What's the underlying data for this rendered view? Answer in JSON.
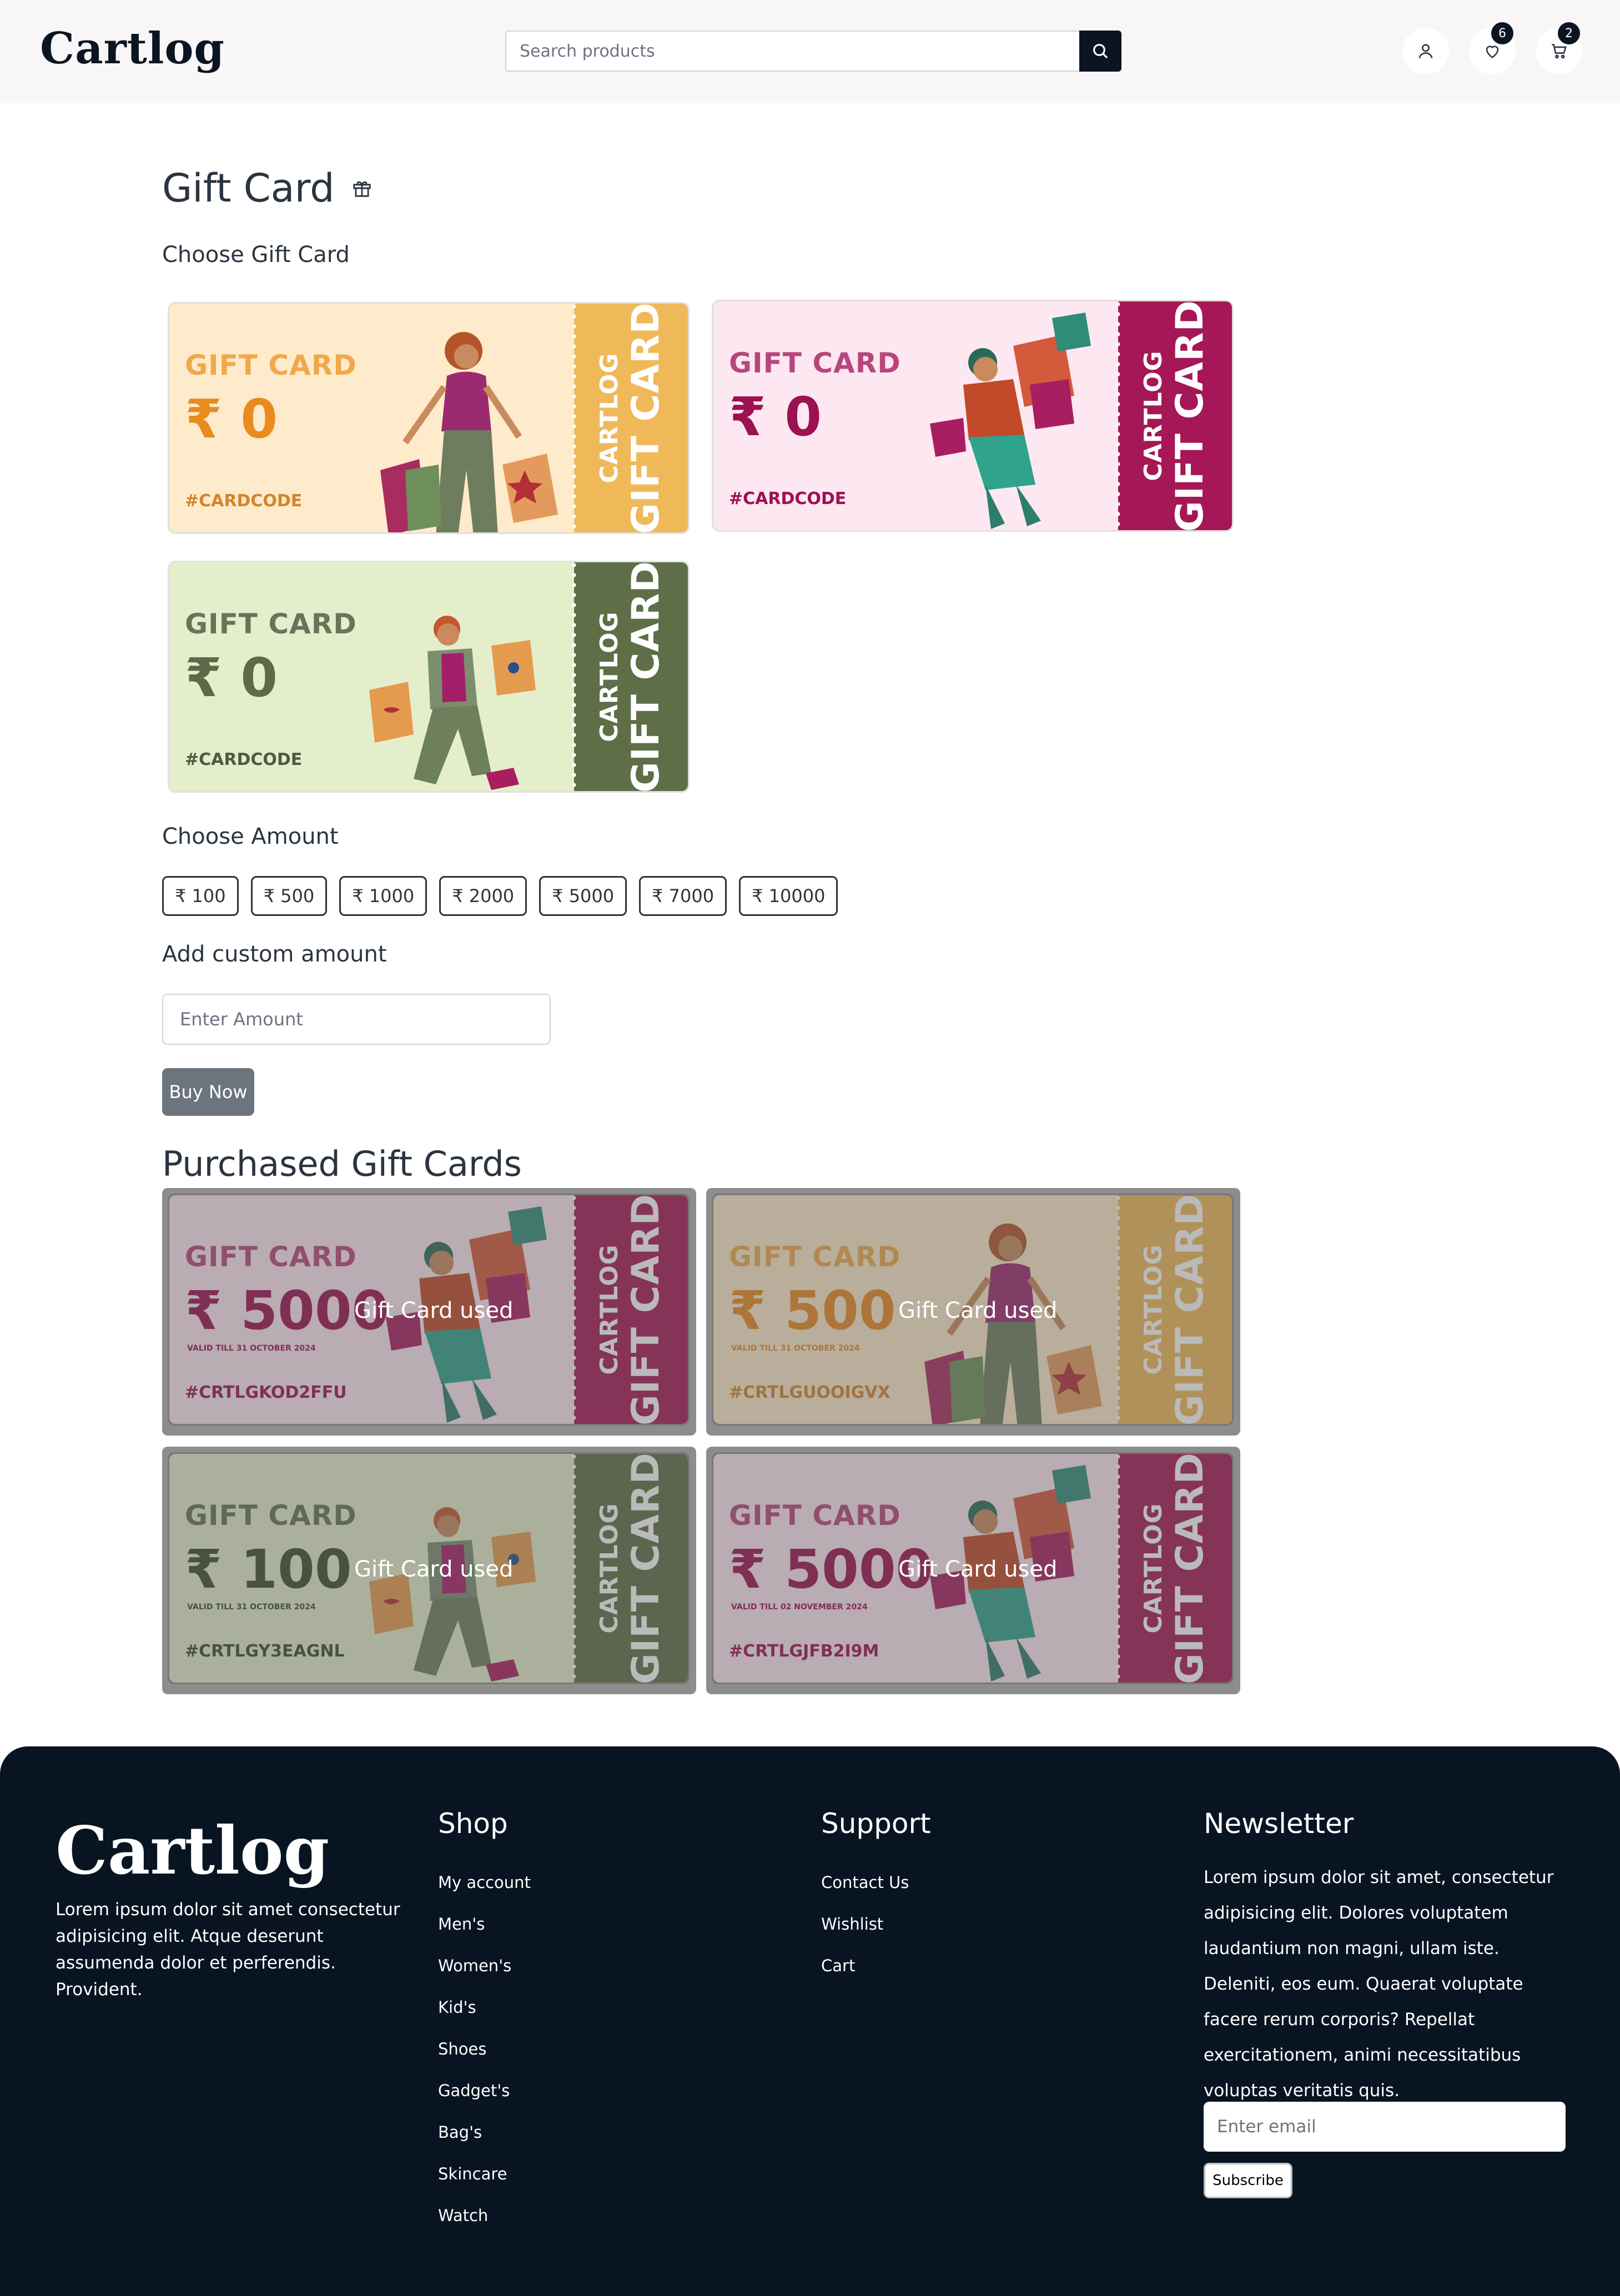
{
  "header": {
    "logo": "Cartlog",
    "search_placeholder": "Search products",
    "wishlist_count": "6",
    "cart_count": "2"
  },
  "main": {
    "title": "Gift Card",
    "choose_card_label": "Choose Gift Card",
    "choose_amount_label": "Choose Amount",
    "custom_amount_label": "Add custom amount",
    "custom_amount_placeholder": "Enter Amount",
    "buy_label": "Buy Now",
    "purchased_title": "Purchased Gift Cards"
  },
  "gift_cards": [
    {
      "label": "GIFT CARD",
      "amount": "₹ 0",
      "code": "#CARDCODE",
      "stub_top": "CARTLOG",
      "stub_bottom": "GIFT CARD",
      "bg": "#fdebcb",
      "stub": "#efb95a",
      "accent": "#efa94a",
      "amount_color": "#e98b1f",
      "code_color": "#d2852c"
    },
    {
      "label": "GIFT CARD",
      "amount": "₹ 0",
      "code": "#CARDCODE",
      "stub_top": "CARTLOG",
      "stub_bottom": "GIFT CARD",
      "bg": "#fde7f1",
      "stub": "#a51756",
      "accent": "#b8467c",
      "amount_color": "#9c1150",
      "code_color": "#9c1150"
    },
    {
      "label": "GIFT CARD",
      "amount": "₹ 0",
      "code": "#CARDCODE",
      "stub_top": "CARTLOG",
      "stub_bottom": "GIFT CARD",
      "bg": "#e4eecb",
      "stub": "#5e6e47",
      "accent": "#67735a",
      "amount_color": "#5d6a4a",
      "code_color": "#4d5940"
    }
  ],
  "amounts": [
    "₹ 100",
    "₹ 500",
    "₹ 1000",
    "₹ 2000",
    "₹ 5000",
    "₹ 7000",
    "₹ 10000"
  ],
  "purchased": [
    {
      "label": "GIFT CARD",
      "amount": "₹ 5000",
      "valid": "VALID TILL 31 OCTOBER 2024",
      "code": "#CRTLGKOD2FFU",
      "status": "Gift Card used",
      "stub_top": "CARTLOG",
      "stub_bottom": "GIFT CARD",
      "bg": "#fde7f1",
      "stub": "#a51756",
      "accent": "#b8467c",
      "amount_color": "#9c1150",
      "code_color": "#9c1150"
    },
    {
      "label": "GIFT CARD",
      "amount": "₹ 500",
      "valid": "VALID TILL 31 OCTOBER 2024",
      "code": "#CRTLGUOOIGVX",
      "status": "Gift Card used",
      "stub_top": "CARTLOG",
      "stub_bottom": "GIFT CARD",
      "bg": "#fdebcb",
      "stub": "#efb95a",
      "accent": "#efa94a",
      "amount_color": "#e98b1f",
      "code_color": "#d2852c"
    },
    {
      "label": "GIFT CARD",
      "amount": "₹ 100",
      "valid": "VALID TILL 31 OCTOBER 2024",
      "code": "#CRTLGY3EAGNL",
      "status": "Gift Card used",
      "stub_top": "CARTLOG",
      "stub_bottom": "GIFT CARD",
      "bg": "#e4eecb",
      "stub": "#5e6e47",
      "accent": "#67735a",
      "amount_color": "#3d4a2d",
      "code_color": "#3d4a2d"
    },
    {
      "label": "GIFT CARD",
      "amount": "₹ 5000",
      "valid": "VALID TILL 02 NOVEMBER 2024",
      "code": "#CRTLGJFB2I9M",
      "status": "Gift Card used",
      "stub_top": "CARTLOG",
      "stub_bottom": "GIFT CARD",
      "bg": "#fde7f1",
      "stub": "#a51756",
      "accent": "#b8467c",
      "amount_color": "#9c1150",
      "code_color": "#9c1150"
    }
  ],
  "footer": {
    "logo": "Cartlog",
    "about": "Lorem ipsum dolor sit amet consectetur adipisicing elit. Atque deserunt assumenda dolor et perferendis. Provident.",
    "shop_title": "Shop",
    "shop_links": [
      "My account",
      "Men's",
      "Women's",
      "Kid's",
      "Shoes",
      "Gadget's",
      "Bag's",
      "Skincare",
      "Watch"
    ],
    "support_title": "Support",
    "support_links": [
      "Contact Us",
      "Wishlist",
      "Cart"
    ],
    "newsletter_title": "Newsletter",
    "newsletter_text": "Lorem ipsum dolor sit amet, consectetur adipisicing elit. Dolores voluptatem laudantium non magni, ullam iste. Deleniti, eos eum. Quaerat voluptate facere rerum corporis? Repellat exercitationem, animi necessitatibus voluptas veritatis quis.",
    "email_placeholder": "Enter email",
    "subscribe_label": "Subscribe"
  }
}
